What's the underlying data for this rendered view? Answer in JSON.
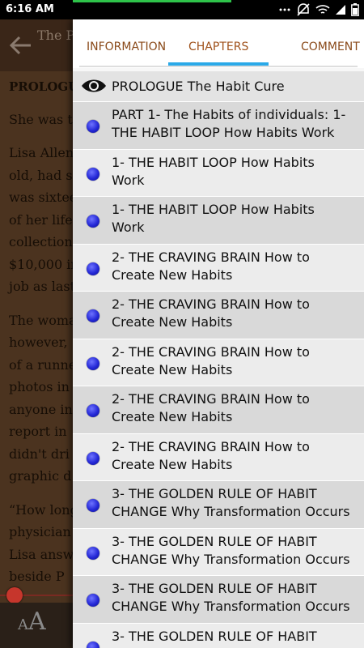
{
  "status_bar": {
    "time": "6:16 AM",
    "battery": ""
  },
  "reader": {
    "title": "The P",
    "text_lines": [
      "PROLOGUE",
      "She was th",
      "Lisa Allen",
      "old, had st",
      "was sixtee",
      "of her life",
      "collection",
      "$10,000 in",
      "job as last",
      "The woma",
      "however,",
      "of a runne",
      "photos in",
      "anyone in",
      "report in",
      "didn't dri",
      "graphic d",
      "“How long",
      "physician",
      "Lisa answ",
      "beside P"
    ],
    "font_size_small": "A",
    "font_size_large": "A"
  },
  "drawer": {
    "tabs": {
      "information": "INFORMATION",
      "chapters": "CHAPTERS",
      "comment": "COMMENT"
    },
    "current_chapter": "PROLOGUE The Habit Cure",
    "chapters": [
      "PART 1- The Habits of individuals: 1-\nTHE HABIT LOOP How Habits Work",
      "1- THE HABIT LOOP How Habits\nWork",
      "1- THE HABIT LOOP How Habits\nWork",
      "2- THE CRAVING BRAIN How to\nCreate New Habits",
      "2- THE CRAVING BRAIN How to\nCreate New Habits",
      "2- THE CRAVING BRAIN How to\nCreate New Habits",
      "2- THE CRAVING BRAIN How to\nCreate New Habits",
      "2- THE CRAVING BRAIN How to\nCreate New Habits",
      "3- THE GOLDEN RULE OF HABIT\nCHANGE Why Transformation Occurs",
      "3- THE GOLDEN RULE OF HABIT\nCHANGE Why Transformation Occurs",
      "3- THE GOLDEN RULE OF HABIT\nCHANGE Why Transformation Occurs",
      "3- THE GOLDEN RULE OF HABIT"
    ]
  },
  "colors": {
    "tab_text": "#8a4a1a",
    "tab_indicator": "#2aa9e8",
    "bullet": "#2428d6"
  }
}
